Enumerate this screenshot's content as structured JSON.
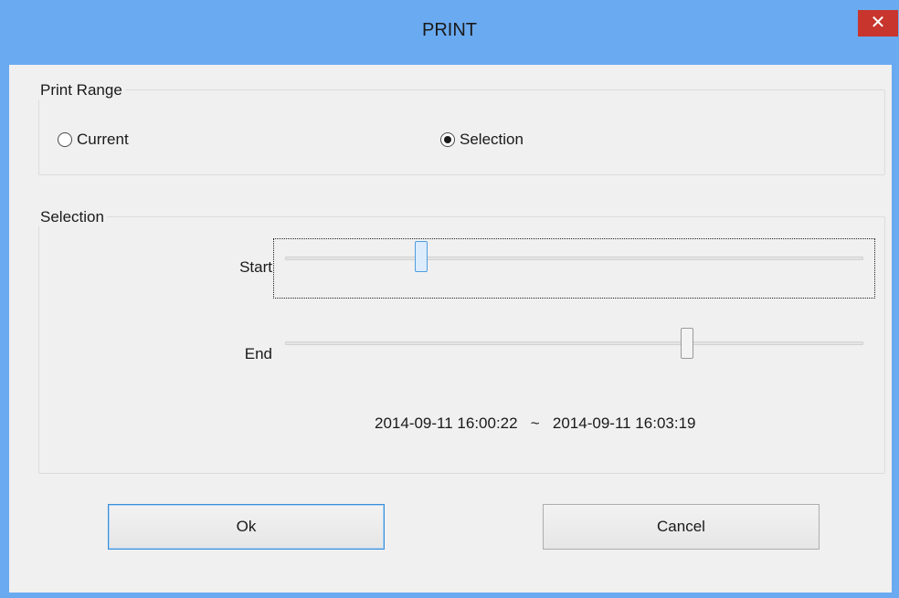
{
  "window": {
    "title": "PRINT",
    "close_glyph": "✕"
  },
  "print_range": {
    "label": "Print Range",
    "options": [
      {
        "label": "Current",
        "checked": false
      },
      {
        "label": "Selection",
        "checked": true
      }
    ]
  },
  "selection": {
    "label": "Selection",
    "start_label": "Start",
    "end_label": "End",
    "start_position": 0.23,
    "end_position": 0.7,
    "range_start": "2014-09-11 16:00:22",
    "range_separator": "~",
    "range_end": "2014-09-11 16:03:19"
  },
  "buttons": {
    "ok_label": "Ok",
    "cancel_label": "Cancel"
  },
  "colors": {
    "title_bar": "#6aaaf0",
    "close_button": "#c8352d",
    "dialog_background": "#f0f0f0"
  }
}
